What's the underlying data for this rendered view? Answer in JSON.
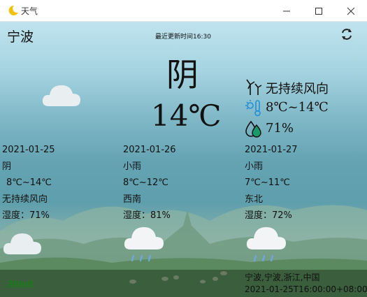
{
  "window": {
    "title": "天气"
  },
  "header": {
    "city": "宁波",
    "updated": "最近更新时间16:30"
  },
  "current": {
    "weather": "阴",
    "temp": "14℃",
    "wind": "无持续风向",
    "temp_range": "8℃~14℃",
    "humidity": "71%"
  },
  "forecast": [
    {
      "date": "2021-01-25",
      "weather": "阴",
      "temp": "8℃~14℃",
      "wind": "无持续风向",
      "humidity": "湿度：71%",
      "icon": "cloud-icon"
    },
    {
      "date": "2021-01-26",
      "weather": "小雨",
      "temp": "8℃~12℃",
      "wind": "西南",
      "humidity": "湿度：81%",
      "icon": "rain-cloud-icon"
    },
    {
      "date": "2021-01-27",
      "weather": "小雨",
      "temp": "7℃~11℃",
      "wind": "东北",
      "humidity": "湿度：72%",
      "icon": "rain-cloud-icon"
    }
  ],
  "footer": {
    "about": "About",
    "location": "宁波,宁波,浙江,中国",
    "timestamp": "2021-01-25T16:00:00+08:00"
  },
  "colors": {
    "sky_top": "#bfe3ee",
    "lake": "#5f9fac",
    "link": "#1a7a1a",
    "humidity_drop": "#1a9a6a"
  }
}
